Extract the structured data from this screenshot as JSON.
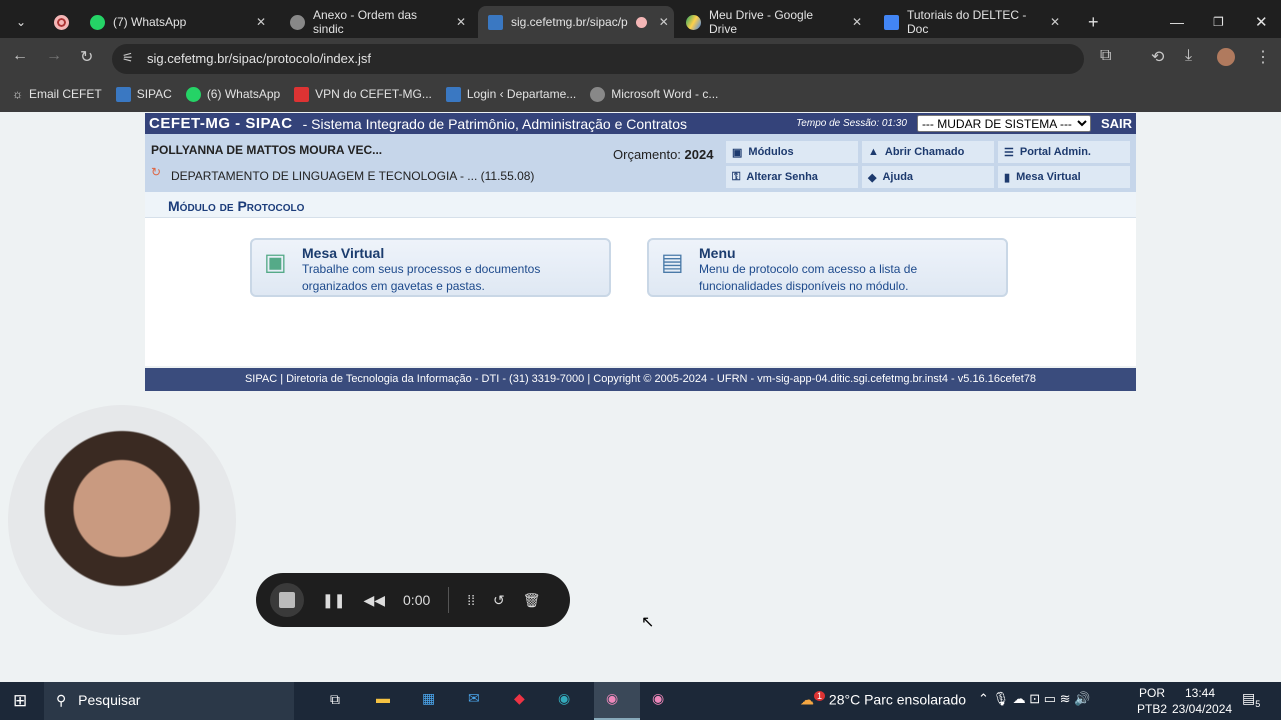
{
  "browser": {
    "tabs": [
      {
        "label": "(7) WhatsApp",
        "active": false
      },
      {
        "label": "Anexo - Ordem das sindic",
        "active": false
      },
      {
        "label": "sig.cefetmg.br/sipac/p",
        "active": true
      },
      {
        "label": "Meu Drive - Google Drive",
        "active": false
      },
      {
        "label": "Tutoriais do DELTEC - Doc",
        "active": false
      }
    ],
    "url": "sig.cefetmg.br/sipac/protocolo/index.jsf",
    "bookmarks": [
      "Email CEFET",
      "SIPAC",
      "(6) WhatsApp",
      "VPN do CEFET-MG...",
      "Login ‹ Departame...",
      "Microsoft Word - c..."
    ]
  },
  "sipac": {
    "brand": "CEFET-MG - SIPAC",
    "subtitle": "- Sistema Integrado de Patrimônio, Administração e Contratos",
    "session_label": "Tempo de Sessão: 01:30",
    "system_select": "--- MUDAR DE SISTEMA ---",
    "logout": "SAIR",
    "user": "POLLYANNA DE MATTOS MOURA VEC...",
    "department": "DEPARTAMENTO DE LINGUAGEM E TECNOLOGIA - ... (11.55.08)",
    "budget_label": "Orçamento:",
    "budget_year": "2024",
    "menu": [
      "Módulos",
      "Abrir Chamado",
      "Portal Admin.",
      "Alterar Senha",
      "Ajuda",
      "Mesa Virtual"
    ],
    "module_title": "Módulo de Protocolo",
    "cards": [
      {
        "title": "Mesa Virtual",
        "desc1": "Trabalhe com seus processos e documentos",
        "desc2": "organizados em gavetas e pastas."
      },
      {
        "title": "Menu",
        "desc1": "Menu de protocolo com acesso a lista de",
        "desc2": "funcionalidades disponíveis no módulo."
      }
    ],
    "footer": "SIPAC | Diretoria de Tecnologia da Informação - DTI - (31) 3319-7000 | Copyright © 2005-2024 - UFRN - vm-sig-app-04.ditic.sgi.cefetmg.br.inst4 - v5.16.16cefet78"
  },
  "recorder": {
    "time": "0:00"
  },
  "taskbar": {
    "search": "Pesquisar",
    "weather": "28°C  Parc ensolarado",
    "weather_badge": "1",
    "lang1": "POR",
    "lang2": "PTB2",
    "time": "13:44",
    "date": "23/04/2024",
    "notifications": "5"
  }
}
